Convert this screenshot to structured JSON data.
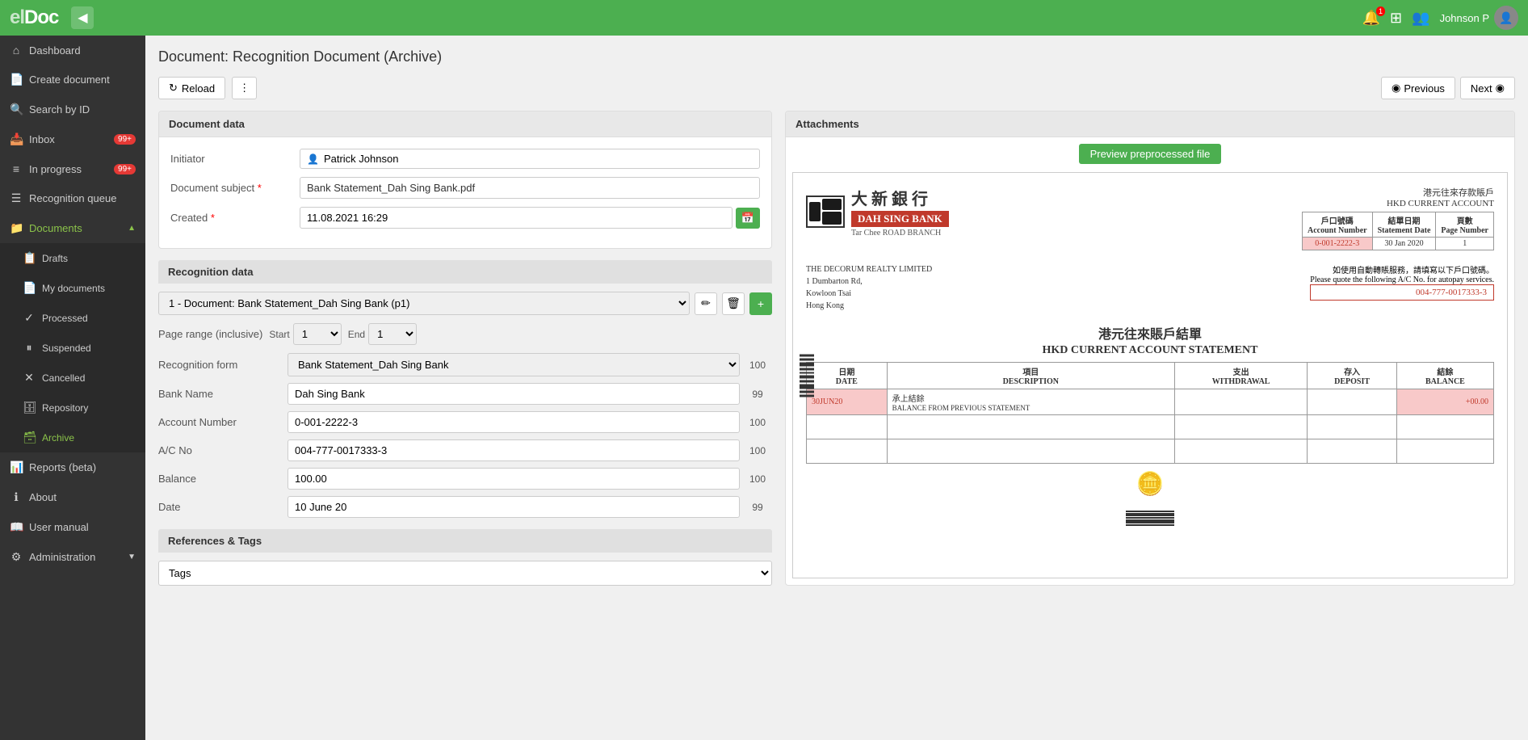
{
  "app": {
    "name": "el",
    "name_bold": "Doc"
  },
  "topnav": {
    "collapse_label": "◀",
    "user_name": "Johnson P",
    "bell_icon": "🔔",
    "grid_icon": "⊞",
    "users_icon": "👥"
  },
  "sidebar": {
    "items": [
      {
        "id": "dashboard",
        "icon": "⌂",
        "label": "Dashboard",
        "active": false
      },
      {
        "id": "create-document",
        "icon": "📄",
        "label": "Create document",
        "active": false
      },
      {
        "id": "search-by-id",
        "icon": "🔍",
        "label": "Search by ID",
        "active": false
      },
      {
        "id": "inbox",
        "icon": "📥",
        "label": "Inbox",
        "badge": "99+",
        "active": false
      },
      {
        "id": "in-progress",
        "icon": "≡",
        "label": "In progress",
        "badge": "99+",
        "active": false
      },
      {
        "id": "recognition-queue",
        "icon": "☰",
        "label": "Recognition queue",
        "active": false
      },
      {
        "id": "documents",
        "icon": "📁",
        "label": "Documents",
        "expanded": true,
        "active": true
      }
    ],
    "sub_items": [
      {
        "id": "drafts",
        "icon": "📋",
        "label": "Drafts",
        "active": false
      },
      {
        "id": "my-documents",
        "icon": "📄",
        "label": "My documents",
        "active": false
      },
      {
        "id": "processed",
        "icon": "✓",
        "label": "Processed",
        "active": false
      },
      {
        "id": "suspended",
        "icon": "⏸",
        "label": "Suspended",
        "active": false
      },
      {
        "id": "cancelled",
        "icon": "✕",
        "label": "Cancelled",
        "active": false
      },
      {
        "id": "repository",
        "icon": "🗄",
        "label": "Repository",
        "active": false
      },
      {
        "id": "archive",
        "icon": "🗃",
        "label": "Archive",
        "active": true
      }
    ],
    "bottom_items": [
      {
        "id": "reports",
        "icon": "📊",
        "label": "Reports (beta)",
        "active": false
      },
      {
        "id": "about",
        "icon": "ℹ",
        "label": "About",
        "active": false
      },
      {
        "id": "user-manual",
        "icon": "📖",
        "label": "User manual",
        "active": false
      },
      {
        "id": "administration",
        "icon": "⚙",
        "label": "Administration",
        "active": false,
        "has_arrow": true
      }
    ]
  },
  "page": {
    "title": "Document: Recognition Document (Archive)",
    "toolbar": {
      "reload_label": "Reload",
      "more_label": "⋮",
      "previous_label": "Previous",
      "next_label": "Next"
    }
  },
  "document_data": {
    "section_title": "Document data",
    "initiator_label": "Initiator",
    "initiator_value": "Patrick Johnson",
    "subject_label": "Document subject",
    "subject_required": true,
    "subject_value": "Bank Statement_Dah Sing Bank.pdf",
    "created_label": "Created",
    "created_required": true,
    "created_value": "11.08.2021 16:29"
  },
  "recognition_data": {
    "section_title": "Recognition data",
    "recognition_select_value": "1 - Document: Bank Statement_Dah Sing Bank (p1)",
    "page_range_label": "Page range (inclusive)",
    "page_range_start_label": "Start",
    "page_range_start_value": "1",
    "page_range_end_label": "End",
    "page_range_end_value": "1",
    "recognition_form_label": "Recognition form",
    "recognition_form_value": "Bank Statement_Dah Sing Bank",
    "recognition_form_score": "100",
    "bank_name_label": "Bank Name",
    "bank_name_value": "Dah Sing Bank",
    "bank_name_score": "99",
    "account_number_label": "Account Number",
    "account_number_value": "0-001-2222-3",
    "account_number_score": "100",
    "ac_no_label": "A/C No",
    "ac_no_value": "004-777-0017333-3",
    "ac_no_score": "100",
    "balance_label": "Balance",
    "balance_value": "100.00",
    "balance_score": "100",
    "date_label": "Date",
    "date_value": "10 June 20",
    "date_score": "99"
  },
  "refs_tags": {
    "section_title": "References & Tags",
    "tags_placeholder": "Tags"
  },
  "attachments": {
    "section_title": "Attachments",
    "preview_btn_label": "Preview preprocessed file"
  },
  "bank_doc": {
    "name_cn": "大 新 銀 行",
    "name_en": "DAH SING BANK",
    "branch": "Tar Chee ROAD    BRANCH",
    "account_type_cn": "港元往來存款賬戶",
    "account_type_en": "HKD CURRENT ACCOUNT",
    "col1": "戶口號碼\nAccount Number",
    "col2": "結單日期\nStatement Date",
    "col3": "頁數\nPage Number",
    "account_no": "0-001-2222-3",
    "statement_date": "30 Jan 2020",
    "page_no": "1",
    "company": "THE DECORUM REALTY LIMITED",
    "address1": "1 Dumbarton Rd,",
    "address2": "Kowloon Tsai",
    "address3": "Hong Kong",
    "ac_label": "004-777-0017333-3",
    "instructions_cn": "如使用自動轉賬服務，請填寫以下戶口號碼。",
    "instructions_en": "Please quote the following A/C No. for autopay services.",
    "statement_title_cn": "港元往來賬戶結單",
    "statement_title_en": "HKD CURRENT ACCOUNT STATEMENT",
    "table_headers": [
      "日期\nDATE",
      "項目\nDESCRIPTION",
      "支出\nWITHDRAWAL",
      "存入\nDEPOSIT",
      "結餘\nBALANCE"
    ],
    "row_date": "30JUN20",
    "row_desc_cn": "承上結餘",
    "row_desc_en": "BALANCE FROM PREVIOUS STATEMENT",
    "row_balance": "+00.00"
  }
}
